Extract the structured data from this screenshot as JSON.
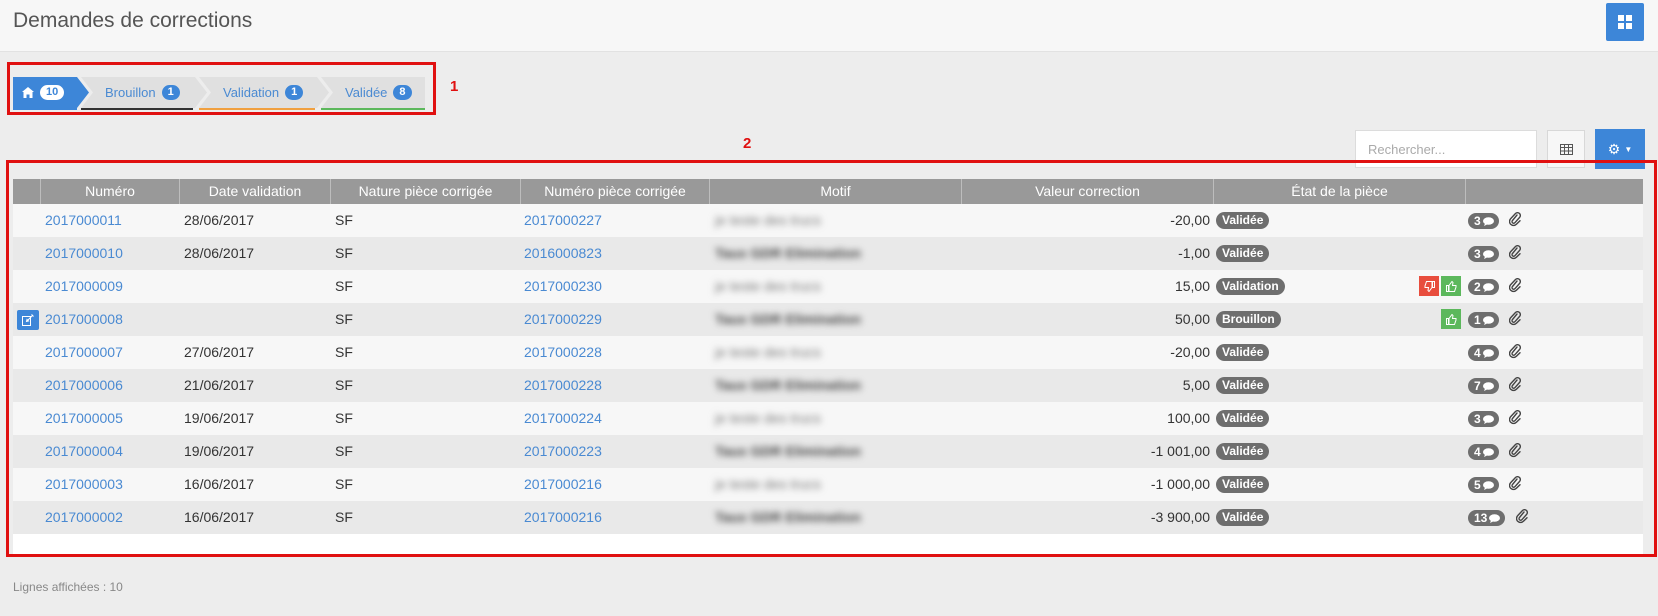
{
  "header": {
    "title": "Demandes de corrections"
  },
  "annotations": {
    "box1": "1",
    "box2": "2"
  },
  "steps": {
    "home_count": "10",
    "items": [
      {
        "label": "Brouillon",
        "count": "1",
        "color": "#333333"
      },
      {
        "label": "Validation",
        "count": "1",
        "color": "#f0a040"
      },
      {
        "label": "Validée",
        "count": "8",
        "color": "#5cb85c"
      }
    ]
  },
  "toolbar": {
    "search_placeholder": "Rechercher..."
  },
  "table": {
    "columns": [
      "Numéro",
      "Date validation",
      "Nature pièce corrigée",
      "Numéro pièce corrigée",
      "Motif",
      "Valeur correction",
      "État de la pièce"
    ],
    "rows": [
      {
        "numero": "2017000011",
        "date": "28/06/2017",
        "nature": "SF",
        "piece": "2017000227",
        "motif": "je teste des trucs",
        "valeur": "-20,00",
        "etat": "Validée",
        "comments": "3"
      },
      {
        "numero": "2017000010",
        "date": "28/06/2017",
        "nature": "SF",
        "piece": "2016000823",
        "motif": "Taux GDR Elimination",
        "valeur": "-1,00",
        "etat": "Validée",
        "comments": "3"
      },
      {
        "numero": "2017000009",
        "date": "",
        "nature": "SF",
        "piece": "2017000230",
        "motif": "je teste des trucs",
        "valeur": "15,00",
        "etat": "Validation",
        "comments": "2"
      },
      {
        "numero": "2017000008",
        "date": "",
        "nature": "SF",
        "piece": "2017000229",
        "motif": "Taux GDR Elimination",
        "valeur": "50,00",
        "etat": "Brouillon",
        "comments": "1"
      },
      {
        "numero": "2017000007",
        "date": "27/06/2017",
        "nature": "SF",
        "piece": "2017000228",
        "motif": "je teste des trucs",
        "valeur": "-20,00",
        "etat": "Validée",
        "comments": "4"
      },
      {
        "numero": "2017000006",
        "date": "21/06/2017",
        "nature": "SF",
        "piece": "2017000228",
        "motif": "Taux GDR Elimination",
        "valeur": "5,00",
        "etat": "Validée",
        "comments": "7"
      },
      {
        "numero": "2017000005",
        "date": "19/06/2017",
        "nature": "SF",
        "piece": "2017000224",
        "motif": "je teste des trucs",
        "valeur": "100,00",
        "etat": "Validée",
        "comments": "3"
      },
      {
        "numero": "2017000004",
        "date": "19/06/2017",
        "nature": "SF",
        "piece": "2017000223",
        "motif": "Taux GDR Elimination",
        "valeur": "-1 001,00",
        "etat": "Validée",
        "comments": "4"
      },
      {
        "numero": "2017000003",
        "date": "16/06/2017",
        "nature": "SF",
        "piece": "2017000216",
        "motif": "je teste des trucs",
        "valeur": "-1 000,00",
        "etat": "Validée",
        "comments": "5"
      },
      {
        "numero": "2017000002",
        "date": "16/06/2017",
        "nature": "SF",
        "piece": "2017000216",
        "motif": "Taux GDR Elimination",
        "valeur": "-3 900,00",
        "etat": "Validée",
        "comments": "13"
      }
    ]
  },
  "footer": {
    "rows_label": "Lignes affichées : 10"
  },
  "colors": {
    "accent": "#3d86d8",
    "annotation": "#e01010",
    "thumb_up": "#5cb85c",
    "thumb_down": "#e84d3d"
  }
}
